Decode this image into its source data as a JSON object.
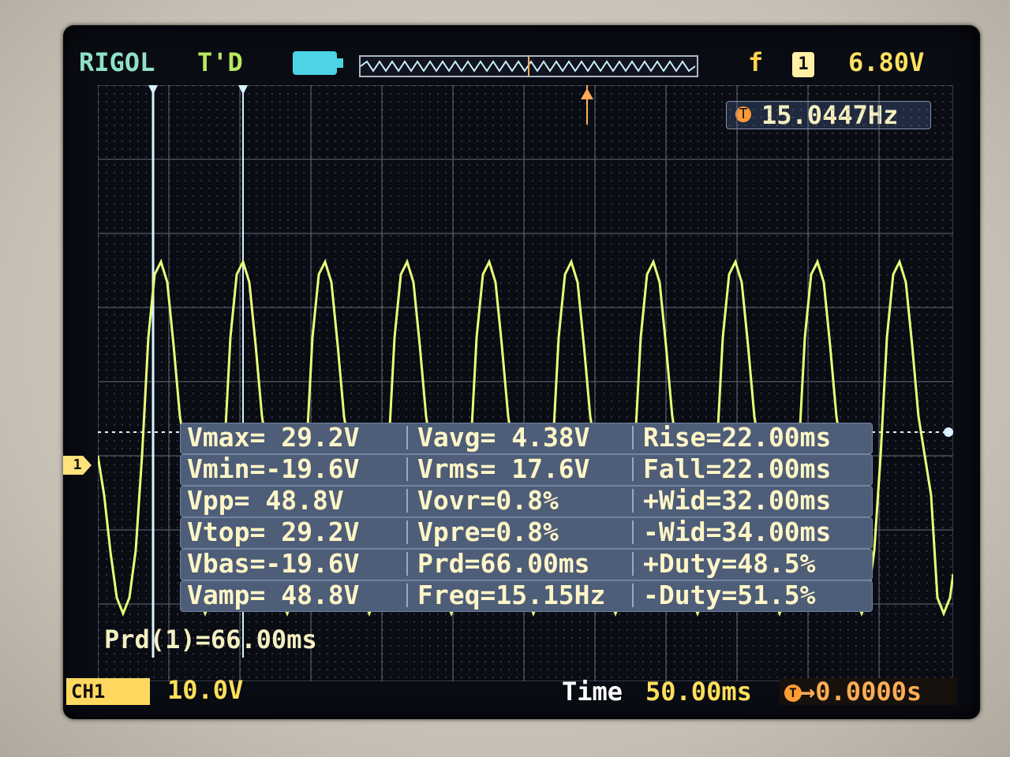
{
  "header": {
    "brand": "RIGOL",
    "state": "T'D",
    "trigger_symbol": "f",
    "channel_badge": "1",
    "trigger_level": "6.80V"
  },
  "frequency_counter": {
    "icon": "T",
    "value": "15.0447Hz"
  },
  "measurements": {
    "rows": [
      {
        "c1": "Vmax= 29.2V",
        "c2": "Vavg= 4.38V",
        "c3": "Rise=22.00ms"
      },
      {
        "c1": "Vmin=-19.6V",
        "c2": "Vrms= 17.6V",
        "c3": "Fall=22.00ms"
      },
      {
        "c1": "Vpp= 48.8V",
        "c2": "Vovr=0.8%",
        "c3": "+Wid=32.00ms"
      },
      {
        "c1": "Vtop= 29.2V",
        "c2": "Vpre=0.8%",
        "c3": "-Wid=34.00ms"
      },
      {
        "c1": "Vbas=-19.6V",
        "c2": "Prd=66.00ms",
        "c3": "+Duty=48.5%"
      },
      {
        "c1": "Vamp= 48.8V",
        "c2": "Freq=15.15Hz",
        "c3": "-Duty=51.5%"
      }
    ]
  },
  "cursor_readout": "Prd(1)=66.00ms",
  "footer": {
    "channel_label": "CH1",
    "volts_per_div": "10.0V",
    "time_label": "Time",
    "time_per_div": "50.00ms",
    "trigger_icon": "T",
    "offset": "→0.0000s"
  },
  "markers": {
    "channel_marker": "1",
    "trigger_marker": "T"
  },
  "colors": {
    "trace": "#e8ff78",
    "grid": "#9aa3b2",
    "panel": "#4e5d78",
    "cursor": "#d8f3ff"
  }
}
